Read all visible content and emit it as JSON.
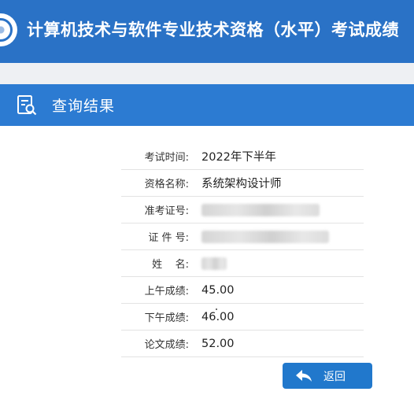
{
  "header": {
    "title": "计算机技术与软件专业技术资格（水平）考试成绩",
    "logo_icon": "exam-logo-icon"
  },
  "result_panel": {
    "title": "查询结果",
    "icon": "document-search-icon"
  },
  "rows": [
    {
      "label": "考试时间:",
      "value": "2022年下半年"
    },
    {
      "label": "资格名称:",
      "value": "系统架构设计师"
    },
    {
      "label": "准考证号:",
      "value": ""
    },
    {
      "label": "证 件 号:",
      "value": ""
    },
    {
      "label": "姓    名:",
      "value": ""
    },
    {
      "label": "上午成绩:",
      "value": "45.00"
    },
    {
      "label": "下午成绩:",
      "value": "46.00"
    },
    {
      "label": "论文成绩:",
      "value": "52.00"
    }
  ],
  "back_button": {
    "label": "返回",
    "icon": "back-arrow-icon"
  },
  "colors": {
    "header": "#2a72c6",
    "panel_header": "#2c7bd2",
    "button": "#2178cc"
  }
}
